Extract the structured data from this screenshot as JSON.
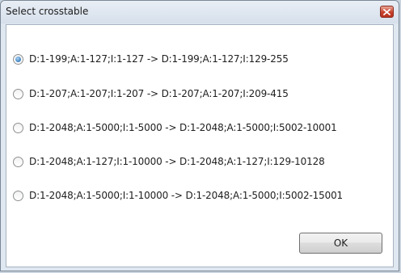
{
  "window": {
    "title": "Select crosstable"
  },
  "options": [
    {
      "label": "D:1-199;A:1-127;I:1-127 -> D:1-199;A:1-127;I:129-255",
      "checked": true
    },
    {
      "label": "D:1-207;A:1-207;I:1-207 -> D:1-207;A:1-207;I:209-415",
      "checked": false
    },
    {
      "label": "D:1-2048;A:1-5000;I:1-5000 -> D:1-2048;A:1-5000;I:5002-10001",
      "checked": false
    },
    {
      "label": "D:1-2048;A:1-127;I:1-10000 -> D:1-2048;A:1-127;I:129-10128",
      "checked": false
    },
    {
      "label": "D:1-2048;A:1-5000;I:1-10000 -> D:1-2048;A:1-5000;I:5002-15001",
      "checked": false
    }
  ],
  "buttons": {
    "ok_label": "OK"
  },
  "icons": {
    "close": "close-icon",
    "radio": "radio-button"
  },
  "colors": {
    "close_button": "#c7412b",
    "radio_selected": "#3d7fbd"
  }
}
